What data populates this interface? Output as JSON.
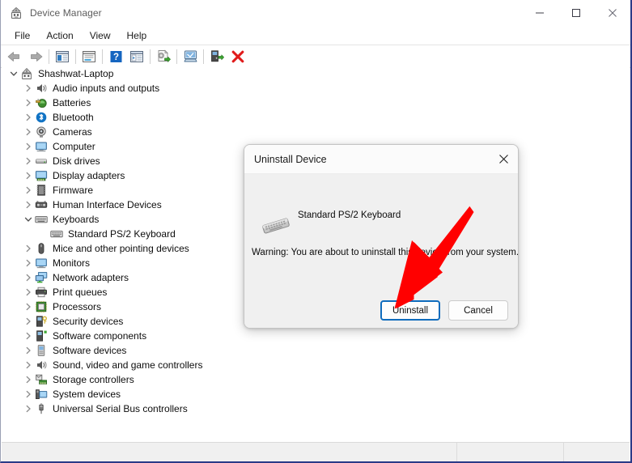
{
  "window": {
    "title": "Device Manager",
    "app_icon": "device-manager-icon",
    "caption": {
      "minimize": "minimize-icon",
      "maximize": "maximize-icon",
      "close": "close-icon"
    }
  },
  "menubar": {
    "items": [
      {
        "label": "File"
      },
      {
        "label": "Action"
      },
      {
        "label": "View"
      },
      {
        "label": "Help"
      }
    ]
  },
  "toolbar": {
    "buttons": [
      {
        "name": "back-button",
        "icon": "back-arrow-icon"
      },
      {
        "name": "forward-button",
        "icon": "forward-arrow-icon"
      },
      {
        "name": "separator-1",
        "icon": "separator"
      },
      {
        "name": "show-hide-console-tree-button",
        "icon": "console-tree-icon"
      },
      {
        "name": "separator-2",
        "icon": "separator"
      },
      {
        "name": "properties-button",
        "icon": "properties-icon"
      },
      {
        "name": "separator-3",
        "icon": "separator"
      },
      {
        "name": "help-button",
        "icon": "help-question-icon"
      },
      {
        "name": "show-hide-action-pane-button",
        "icon": "action-pane-icon"
      },
      {
        "name": "separator-4",
        "icon": "separator"
      },
      {
        "name": "update-driver-button",
        "icon": "update-driver-icon"
      },
      {
        "name": "separator-5",
        "icon": "separator"
      },
      {
        "name": "scan-hardware-changes-button",
        "icon": "scan-hardware-icon"
      },
      {
        "name": "separator-6",
        "icon": "separator"
      },
      {
        "name": "enable-device-button",
        "icon": "enable-device-icon"
      },
      {
        "name": "uninstall-device-button",
        "icon": "red-x-icon"
      }
    ]
  },
  "tree": {
    "root": {
      "label": "Shashwat-Laptop",
      "icon": "computer-root-icon",
      "expanded": true,
      "indent": 0
    },
    "items": [
      {
        "label": "Audio inputs and outputs",
        "icon": "speaker-icon",
        "expanded": false,
        "has_chevron": true,
        "indent": 1
      },
      {
        "label": "Batteries",
        "icon": "battery-icon",
        "expanded": false,
        "has_chevron": true,
        "indent": 1
      },
      {
        "label": "Bluetooth",
        "icon": "bluetooth-icon",
        "expanded": false,
        "has_chevron": true,
        "indent": 1
      },
      {
        "label": "Cameras",
        "icon": "camera-icon",
        "expanded": false,
        "has_chevron": true,
        "indent": 1
      },
      {
        "label": "Computer",
        "icon": "monitor-icon",
        "expanded": false,
        "has_chevron": true,
        "indent": 1
      },
      {
        "label": "Disk drives",
        "icon": "disk-drive-icon",
        "expanded": false,
        "has_chevron": true,
        "indent": 1
      },
      {
        "label": "Display adapters",
        "icon": "display-adapter-icon",
        "expanded": false,
        "has_chevron": true,
        "indent": 1
      },
      {
        "label": "Firmware",
        "icon": "firmware-chip-icon",
        "expanded": false,
        "has_chevron": true,
        "indent": 1
      },
      {
        "label": "Human Interface Devices",
        "icon": "hid-icon",
        "expanded": false,
        "has_chevron": true,
        "indent": 1
      },
      {
        "label": "Keyboards",
        "icon": "keyboard-icon",
        "expanded": true,
        "has_chevron": true,
        "indent": 1
      },
      {
        "label": "Standard PS/2 Keyboard",
        "icon": "keyboard-device-icon",
        "expanded": false,
        "has_chevron": false,
        "indent": 2
      },
      {
        "label": "Mice and other pointing devices",
        "icon": "mouse-icon",
        "expanded": false,
        "has_chevron": true,
        "indent": 1
      },
      {
        "label": "Monitors",
        "icon": "monitor-icon",
        "expanded": false,
        "has_chevron": true,
        "indent": 1
      },
      {
        "label": "Network adapters",
        "icon": "network-adapter-icon",
        "expanded": false,
        "has_chevron": true,
        "indent": 1
      },
      {
        "label": "Print queues",
        "icon": "printer-icon",
        "expanded": false,
        "has_chevron": true,
        "indent": 1
      },
      {
        "label": "Processors",
        "icon": "processor-icon",
        "expanded": false,
        "has_chevron": true,
        "indent": 1
      },
      {
        "label": "Security devices",
        "icon": "security-device-icon",
        "expanded": false,
        "has_chevron": true,
        "indent": 1
      },
      {
        "label": "Software components",
        "icon": "software-component-icon",
        "expanded": false,
        "has_chevron": true,
        "indent": 1
      },
      {
        "label": "Software devices",
        "icon": "software-device-icon",
        "expanded": false,
        "has_chevron": true,
        "indent": 1
      },
      {
        "label": "Sound, video and game controllers",
        "icon": "speaker-icon",
        "expanded": false,
        "has_chevron": true,
        "indent": 1
      },
      {
        "label": "Storage controllers",
        "icon": "storage-controller-icon",
        "expanded": false,
        "has_chevron": true,
        "indent": 1
      },
      {
        "label": "System devices",
        "icon": "system-device-icon",
        "expanded": false,
        "has_chevron": true,
        "indent": 1
      },
      {
        "label": "Universal Serial Bus controllers",
        "icon": "usb-icon",
        "expanded": false,
        "has_chevron": true,
        "indent": 1
      }
    ]
  },
  "statusbar": {
    "pane1": "",
    "pane2": "",
    "pane3": ""
  },
  "dialog": {
    "title": "Uninstall Device",
    "close_icon": "close-icon",
    "device_icon": "keyboard-device-icon",
    "device_name": "Standard PS/2 Keyboard",
    "warning": "Warning: You are about to uninstall this device from your system.",
    "buttons": {
      "confirm": "Uninstall",
      "cancel": "Cancel"
    }
  },
  "annotation": {
    "arrow": "red-arrow-pointing-to-uninstall-button",
    "color": "#FF0000"
  },
  "colors": {
    "accent": "#0f6cbd",
    "window_border": "#2b3a87",
    "dialog_background": "#f0f0f0",
    "statusbar_background": "#f0f0f0",
    "annotation_red": "#FF0000"
  }
}
